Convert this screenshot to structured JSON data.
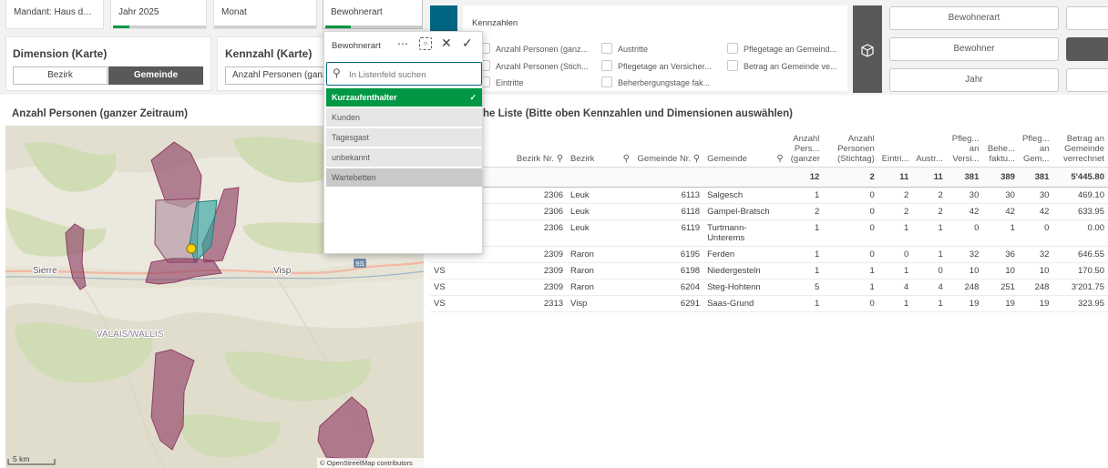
{
  "filters": {
    "mandant": "Mandant: Haus der G...",
    "jahr": "Jahr 2025",
    "monat": "Monat",
    "bewohnerart": "Bewohnerart"
  },
  "kennzahlen_panel": {
    "title": "Kennzahlen",
    "options": [
      "Anzahl Personen (ganz...",
      "Austritte",
      "Pflegetage an Gemeind...",
      "Anzahl Personen (Stich...",
      "Pflegetage an Versicher...",
      "Betrag an Gemeinde ve...",
      "Eintritte",
      "Beherbergungstage fak..."
    ]
  },
  "dimension_panel": {
    "title": "Dimension (Karte)",
    "options": [
      "Bezirk",
      "Gemeinde"
    ],
    "selected": "Gemeinde"
  },
  "kennzahl_panel": {
    "title": "Kennzahl (Karte)",
    "selected": "Anzahl Personen (ganzer"
  },
  "right_buttons": {
    "bewohnerart": "Bewohnerart",
    "bewohner": "Bewohner",
    "jahr": "Jahr"
  },
  "dropdown": {
    "title": "Bewohnerart",
    "search_placeholder": "In Listenfeld suchen",
    "items": [
      {
        "label": "Kurzaufenthalter",
        "state": "selected"
      },
      {
        "label": "Kunden",
        "state": "alternative"
      },
      {
        "label": "Tagesgast",
        "state": "alternative"
      },
      {
        "label": "unbekannt",
        "state": "alternative"
      },
      {
        "label": "Wartebetten",
        "state": "excluded"
      }
    ]
  },
  "map": {
    "title": "Anzahl Personen (ganzer Zeitraum)",
    "labels": {
      "sierre": "Sierre",
      "visp": "Visp",
      "valais": "VALAIS/WALLIS",
      "road": "9S"
    },
    "scale": "5 km",
    "attribution": "© OpenStreetMap contributors"
  },
  "table": {
    "title_visible": "he Liste (Bitte oben Kennzahlen und Dimensionen auswählen)",
    "headers": [
      "Bezirk Nr.",
      "Bezirk",
      "Gemeinde Nr.",
      "Gemeinde",
      "Anzahl Pers... (ganzer",
      "Anzahl Personen (Stichtag)",
      "Eintri...",
      "Austr...",
      "Pfleg... an Versi...",
      "Behe... faktu...",
      "Pfleg... an Gem...",
      "Betrag an Gemeinde verrechnet"
    ],
    "totals": [
      "12",
      "2",
      "11",
      "11",
      "381",
      "389",
      "381",
      "5'445.80"
    ],
    "rows": [
      [
        "",
        "2306",
        "Leuk",
        "6113",
        "Salgesch",
        "1",
        "0",
        "2",
        "2",
        "30",
        "30",
        "30",
        "469.10"
      ],
      [
        "",
        "2306",
        "Leuk",
        "6118",
        "Gampel-Bratsch",
        "2",
        "0",
        "2",
        "2",
        "42",
        "42",
        "42",
        "633.95"
      ],
      [
        "",
        "2306",
        "Leuk",
        "6119",
        "Turtmann-Unterems",
        "1",
        "0",
        "1",
        "1",
        "0",
        "1",
        "0",
        "0.00"
      ],
      [
        "",
        "2309",
        "Raron",
        "6195",
        "Ferden",
        "1",
        "0",
        "0",
        "1",
        "32",
        "36",
        "32",
        "646.55"
      ],
      [
        "VS",
        "2309",
        "Raron",
        "6198",
        "Niedergesteln",
        "1",
        "1",
        "1",
        "0",
        "10",
        "10",
        "10",
        "170.50"
      ],
      [
        "VS",
        "2309",
        "Raron",
        "6204",
        "Steg-Hohtenn",
        "5",
        "1",
        "4",
        "4",
        "248",
        "251",
        "248",
        "3'201.75"
      ],
      [
        "VS",
        "2313",
        "Visp",
        "6291",
        "Saas-Grund",
        "1",
        "0",
        "1",
        "1",
        "19",
        "19",
        "19",
        "323.95"
      ]
    ]
  },
  "colors": {
    "green": "#009845",
    "dark_gray": "#595959",
    "teal": "#006580",
    "region_fill": "#8e3e63",
    "highlight": "#2aa6a0"
  }
}
